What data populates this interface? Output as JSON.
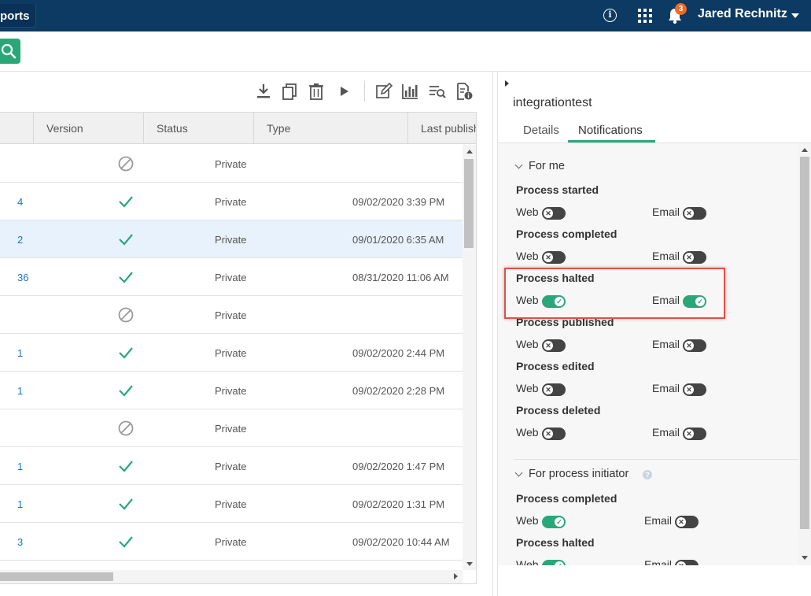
{
  "topbar": {
    "tab_label": "ports",
    "info_icon": "i",
    "notification_count": "3",
    "user_name": "Jared Rechnitz"
  },
  "table": {
    "columns": [
      "Version",
      "Status",
      "Type",
      "Last publish"
    ],
    "rows": [
      {
        "version": "",
        "status": "disabled",
        "type": "Private",
        "last_published": ""
      },
      {
        "version": "4",
        "status": "check",
        "type": "Private",
        "last_published": "09/02/2020 3:39 PM"
      },
      {
        "version": "2",
        "status": "check",
        "type": "Private",
        "last_published": "09/01/2020 6:35 AM",
        "selected": true
      },
      {
        "version": "36",
        "status": "check",
        "type": "Private",
        "last_published": "08/31/2020 11:06 AM"
      },
      {
        "version": "",
        "status": "disabled",
        "type": "Private",
        "last_published": ""
      },
      {
        "version": "1",
        "status": "check",
        "type": "Private",
        "last_published": "09/02/2020 2:44 PM"
      },
      {
        "version": "1",
        "status": "check",
        "type": "Private",
        "last_published": "09/02/2020 2:28 PM"
      },
      {
        "version": "",
        "status": "disabled",
        "type": "Private",
        "last_published": ""
      },
      {
        "version": "1",
        "status": "check",
        "type": "Private",
        "last_published": "09/02/2020 1:47 PM"
      },
      {
        "version": "1",
        "status": "check",
        "type": "Private",
        "last_published": "09/02/2020 1:31 PM"
      },
      {
        "version": "3",
        "status": "check",
        "type": "Private",
        "last_published": "09/02/2020 10:44 AM"
      }
    ]
  },
  "panel": {
    "title": "integrationtest",
    "tabs": [
      "Details",
      "Notifications"
    ],
    "active_tab": "Notifications",
    "for_me": {
      "heading": "For me",
      "web_label": "Web",
      "email_label": "Email",
      "items": [
        {
          "label": "Process started",
          "web": false,
          "email": false
        },
        {
          "label": "Process completed",
          "web": false,
          "email": false
        },
        {
          "label": "Process halted",
          "web": true,
          "email": true
        },
        {
          "label": "Process published",
          "web": false,
          "email": false
        },
        {
          "label": "Process edited",
          "web": false,
          "email": false
        },
        {
          "label": "Process deleted",
          "web": false,
          "email": false
        }
      ]
    },
    "for_initiator": {
      "heading": "For process initiator",
      "help_icon": "?",
      "web_label": "Web",
      "email_label": "Email",
      "items": [
        {
          "label": "Process completed",
          "web": true,
          "email": false
        },
        {
          "label": "Process halted",
          "web": true,
          "email": false
        }
      ]
    }
  },
  "colors": {
    "topbar": "#0c3a63",
    "accent": "#2aa779",
    "link": "#1b74c4",
    "highlight": "#e05244",
    "badge": "#f26a21"
  },
  "icons": [
    "search-icon",
    "info-icon",
    "apps-grid-icon",
    "bell-icon",
    "download-icon",
    "copy-icon",
    "trash-icon",
    "play-icon",
    "edit-icon",
    "bar-chart-icon",
    "list-search-icon",
    "document-info-icon",
    "check-icon",
    "disabled-icon"
  ]
}
